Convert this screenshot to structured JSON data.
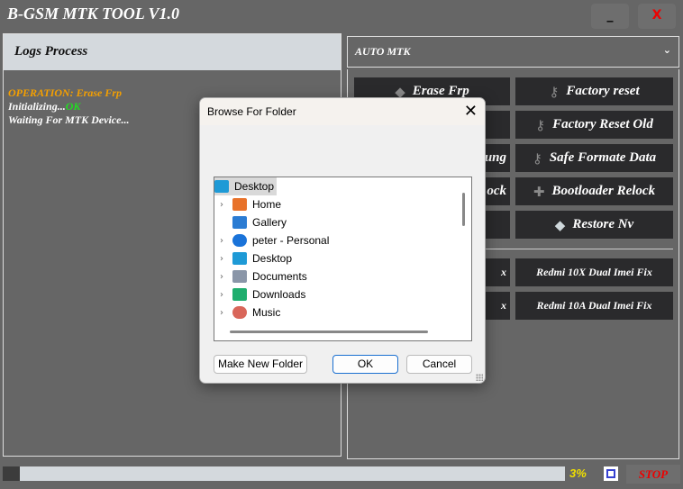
{
  "app": {
    "title": "B-GSM MTK TOOL V1.0",
    "minimize": "_",
    "close": "X"
  },
  "logs": {
    "header": "Logs Process",
    "lines": {
      "op": "OPERATION: Erase Frp",
      "init": "Initializing...",
      "ok": "OK",
      "wait": "Waiting For MTK Device..."
    }
  },
  "mode": {
    "selected": "AUTO MTK",
    "chevron": "⌄"
  },
  "buttons": {
    "erase_frp": "Erase Frp",
    "factory_reset": "Factory reset",
    "factory_reset_old": "Factory Reset Old",
    "safe_formate": "Safe Formate Data",
    "bootloader_relock": "Bootloader Relock",
    "restore_nv": "Restore Nv",
    "frag_row3": "ung",
    "frag_row4": "ock",
    "frag_row6": "x",
    "frag_row7": "x",
    "redmi_10x": "Redmi 10X Dual Imei Fix",
    "redmi_10a": "Redmi 10A Dual Imei Fix"
  },
  "status": {
    "progress_percent": 3,
    "progress_label": "3%",
    "stop": "STOP"
  },
  "dialog": {
    "title": "Browse For Folder",
    "close": "✕",
    "tree": [
      {
        "label": "Desktop",
        "icon": "desktop-icon",
        "selected": true
      },
      {
        "label": "Home",
        "icon": "home-icon",
        "expandable": true
      },
      {
        "label": "Gallery",
        "icon": "gallery-icon",
        "expandable": false
      },
      {
        "label": "peter - Personal",
        "icon": "onedrive-icon",
        "expandable": true
      },
      {
        "label": "Desktop",
        "icon": "desktop-icon",
        "expandable": true
      },
      {
        "label": "Documents",
        "icon": "documents-icon",
        "expandable": true
      },
      {
        "label": "Downloads",
        "icon": "downloads-icon",
        "expandable": true
      },
      {
        "label": "Music",
        "icon": "music-icon",
        "expandable": true
      }
    ],
    "make_new_folder": "Make New Folder",
    "ok": "OK",
    "cancel": "Cancel"
  },
  "colors": {
    "bg": "#666666",
    "button": "#2a2a2c",
    "orange": "#f5a000",
    "green": "#22dd22",
    "stop": "#ee0000",
    "percent": "#f0e000"
  }
}
